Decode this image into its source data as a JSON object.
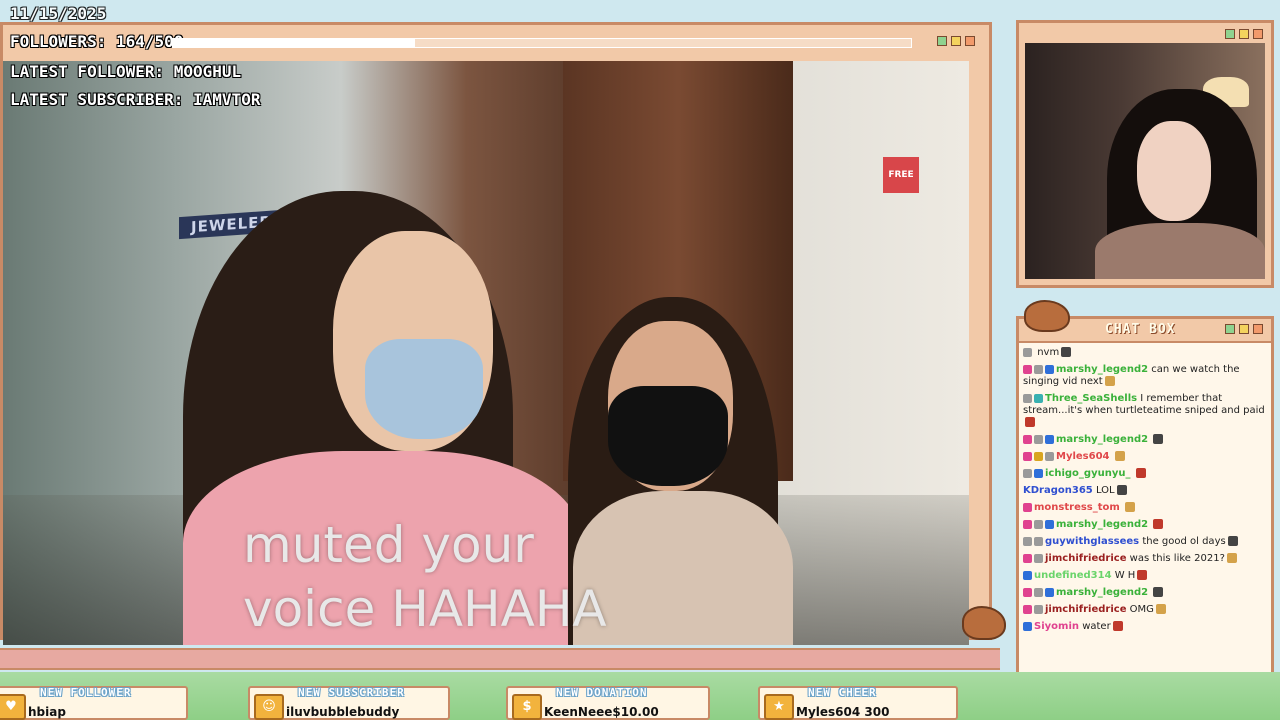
{
  "overlay": {
    "date": "11/15/2025",
    "followers_label": "FOLLOWERS: 164/500",
    "followers_progress": 0.328,
    "latest_follower": "LATEST FOLLOWER: MOOGHUL",
    "latest_subscriber": "LATEST SUBSCRIBER: IAMVTOR"
  },
  "video": {
    "caption_line1": "muted your",
    "caption_line2": "voice HAHAHA",
    "sign_text": "JEWELERS",
    "free_sign": "FREE"
  },
  "chat": {
    "title": "CHAT BOX",
    "messages": [
      {
        "user": "",
        "text": "nvm",
        "color": "#3ab13a"
      },
      {
        "user": "marshy_legend2",
        "text": "can we watch the singing vid next",
        "color": "#3ab13a"
      },
      {
        "user": "Three_SeaShells",
        "text": "I remember that stream...it's when turtleteatime sniped and paid",
        "color": "#3ab13a"
      },
      {
        "user": "marshy_legend2",
        "text": "",
        "color": "#3ab13a"
      },
      {
        "user": "Myles604",
        "text": "",
        "color": "#e0484a"
      },
      {
        "user": "ichigo_gyunyu_",
        "text": "",
        "color": "#3ab13a"
      },
      {
        "user": "KDragon365",
        "text": "LOL",
        "color": "#2f4fd0"
      },
      {
        "user": "monstress_tom",
        "text": "",
        "color": "#e0484a"
      },
      {
        "user": "marshy_legend2",
        "text": "",
        "color": "#3ab13a"
      },
      {
        "user": "guywithglassees",
        "text": "the good ol days",
        "color": "#2f4fd0"
      },
      {
        "user": "jimchifriedrice",
        "text": "was this like 2021?",
        "color": "#9a1f1f"
      },
      {
        "user": "undefined314",
        "text": "W H",
        "color": "#6ad46a"
      },
      {
        "user": "marshy_legend2",
        "text": "",
        "color": "#3ab13a"
      },
      {
        "user": "jimchifriedrice",
        "text": "OMG",
        "color": "#9a1f1f"
      },
      {
        "user": "Siyomin",
        "text": "water",
        "color": "#e0428f"
      }
    ]
  },
  "alerts": {
    "follow": {
      "title": "NEW FOLLOWER",
      "value": "hbiap"
    },
    "sub": {
      "title": "NEW SUBSCRIBER",
      "value": "iluvbubblebuddy"
    },
    "donation": {
      "title": "NEW DONATION",
      "value": "KeenNeee$10.00"
    },
    "cheer": {
      "title": "NEW CHEER",
      "value": "Myles604 300"
    }
  },
  "icons": {
    "alert_follow": "heart-icon",
    "alert_sub": "person-icon",
    "alert_donation": "dollar-icon",
    "alert_cheer": "star-icon"
  }
}
